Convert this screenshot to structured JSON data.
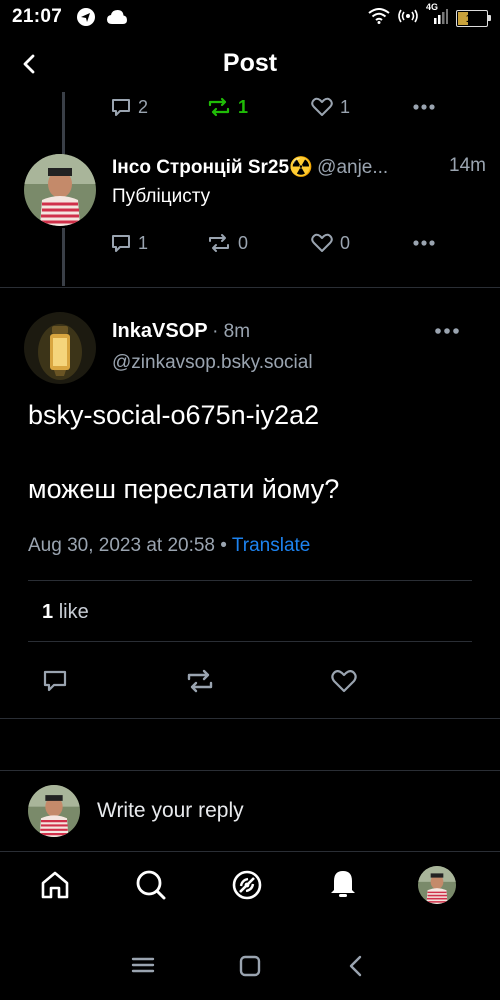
{
  "status_bar": {
    "time": "21:07",
    "battery": "17",
    "network": "4G"
  },
  "header": {
    "title": "Post"
  },
  "parent_post_actions": {
    "replies": "2",
    "reposts": "1",
    "likes": "1"
  },
  "reply_post": {
    "author_name": "Інсо Стронцій Sr25☢️",
    "author_handle": "@anje...",
    "time": "14m",
    "text": "Публіцисту",
    "replies": "1",
    "reposts": "0",
    "likes": "0"
  },
  "main_post": {
    "author_name": "InkaVSOP",
    "time": "· 8m",
    "author_handle": "@zinkavsop.bsky.social",
    "text_line1": "bsky-social-o675n-iy2a2",
    "text_line2": "можеш переслати йому?",
    "timestamp": "Aug 30, 2023 at 20:58",
    "separator": " • ",
    "translate_label": "Translate",
    "likes_count": "1",
    "likes_label": "like"
  },
  "composer": {
    "placeholder": "Write your reply"
  },
  "colors": {
    "background": "#000000",
    "accent": "#1d83f0",
    "repost_active": "#20bc07",
    "muted": "#9aa4b0",
    "divider": "#2a2e35"
  },
  "icons": {
    "nav": [
      "home-icon",
      "search-icon",
      "feeds-icon",
      "notifications-icon",
      "profile-avatar"
    ],
    "system_nav": [
      "menu-icon",
      "home-square-icon",
      "back-triangle-icon"
    ]
  }
}
